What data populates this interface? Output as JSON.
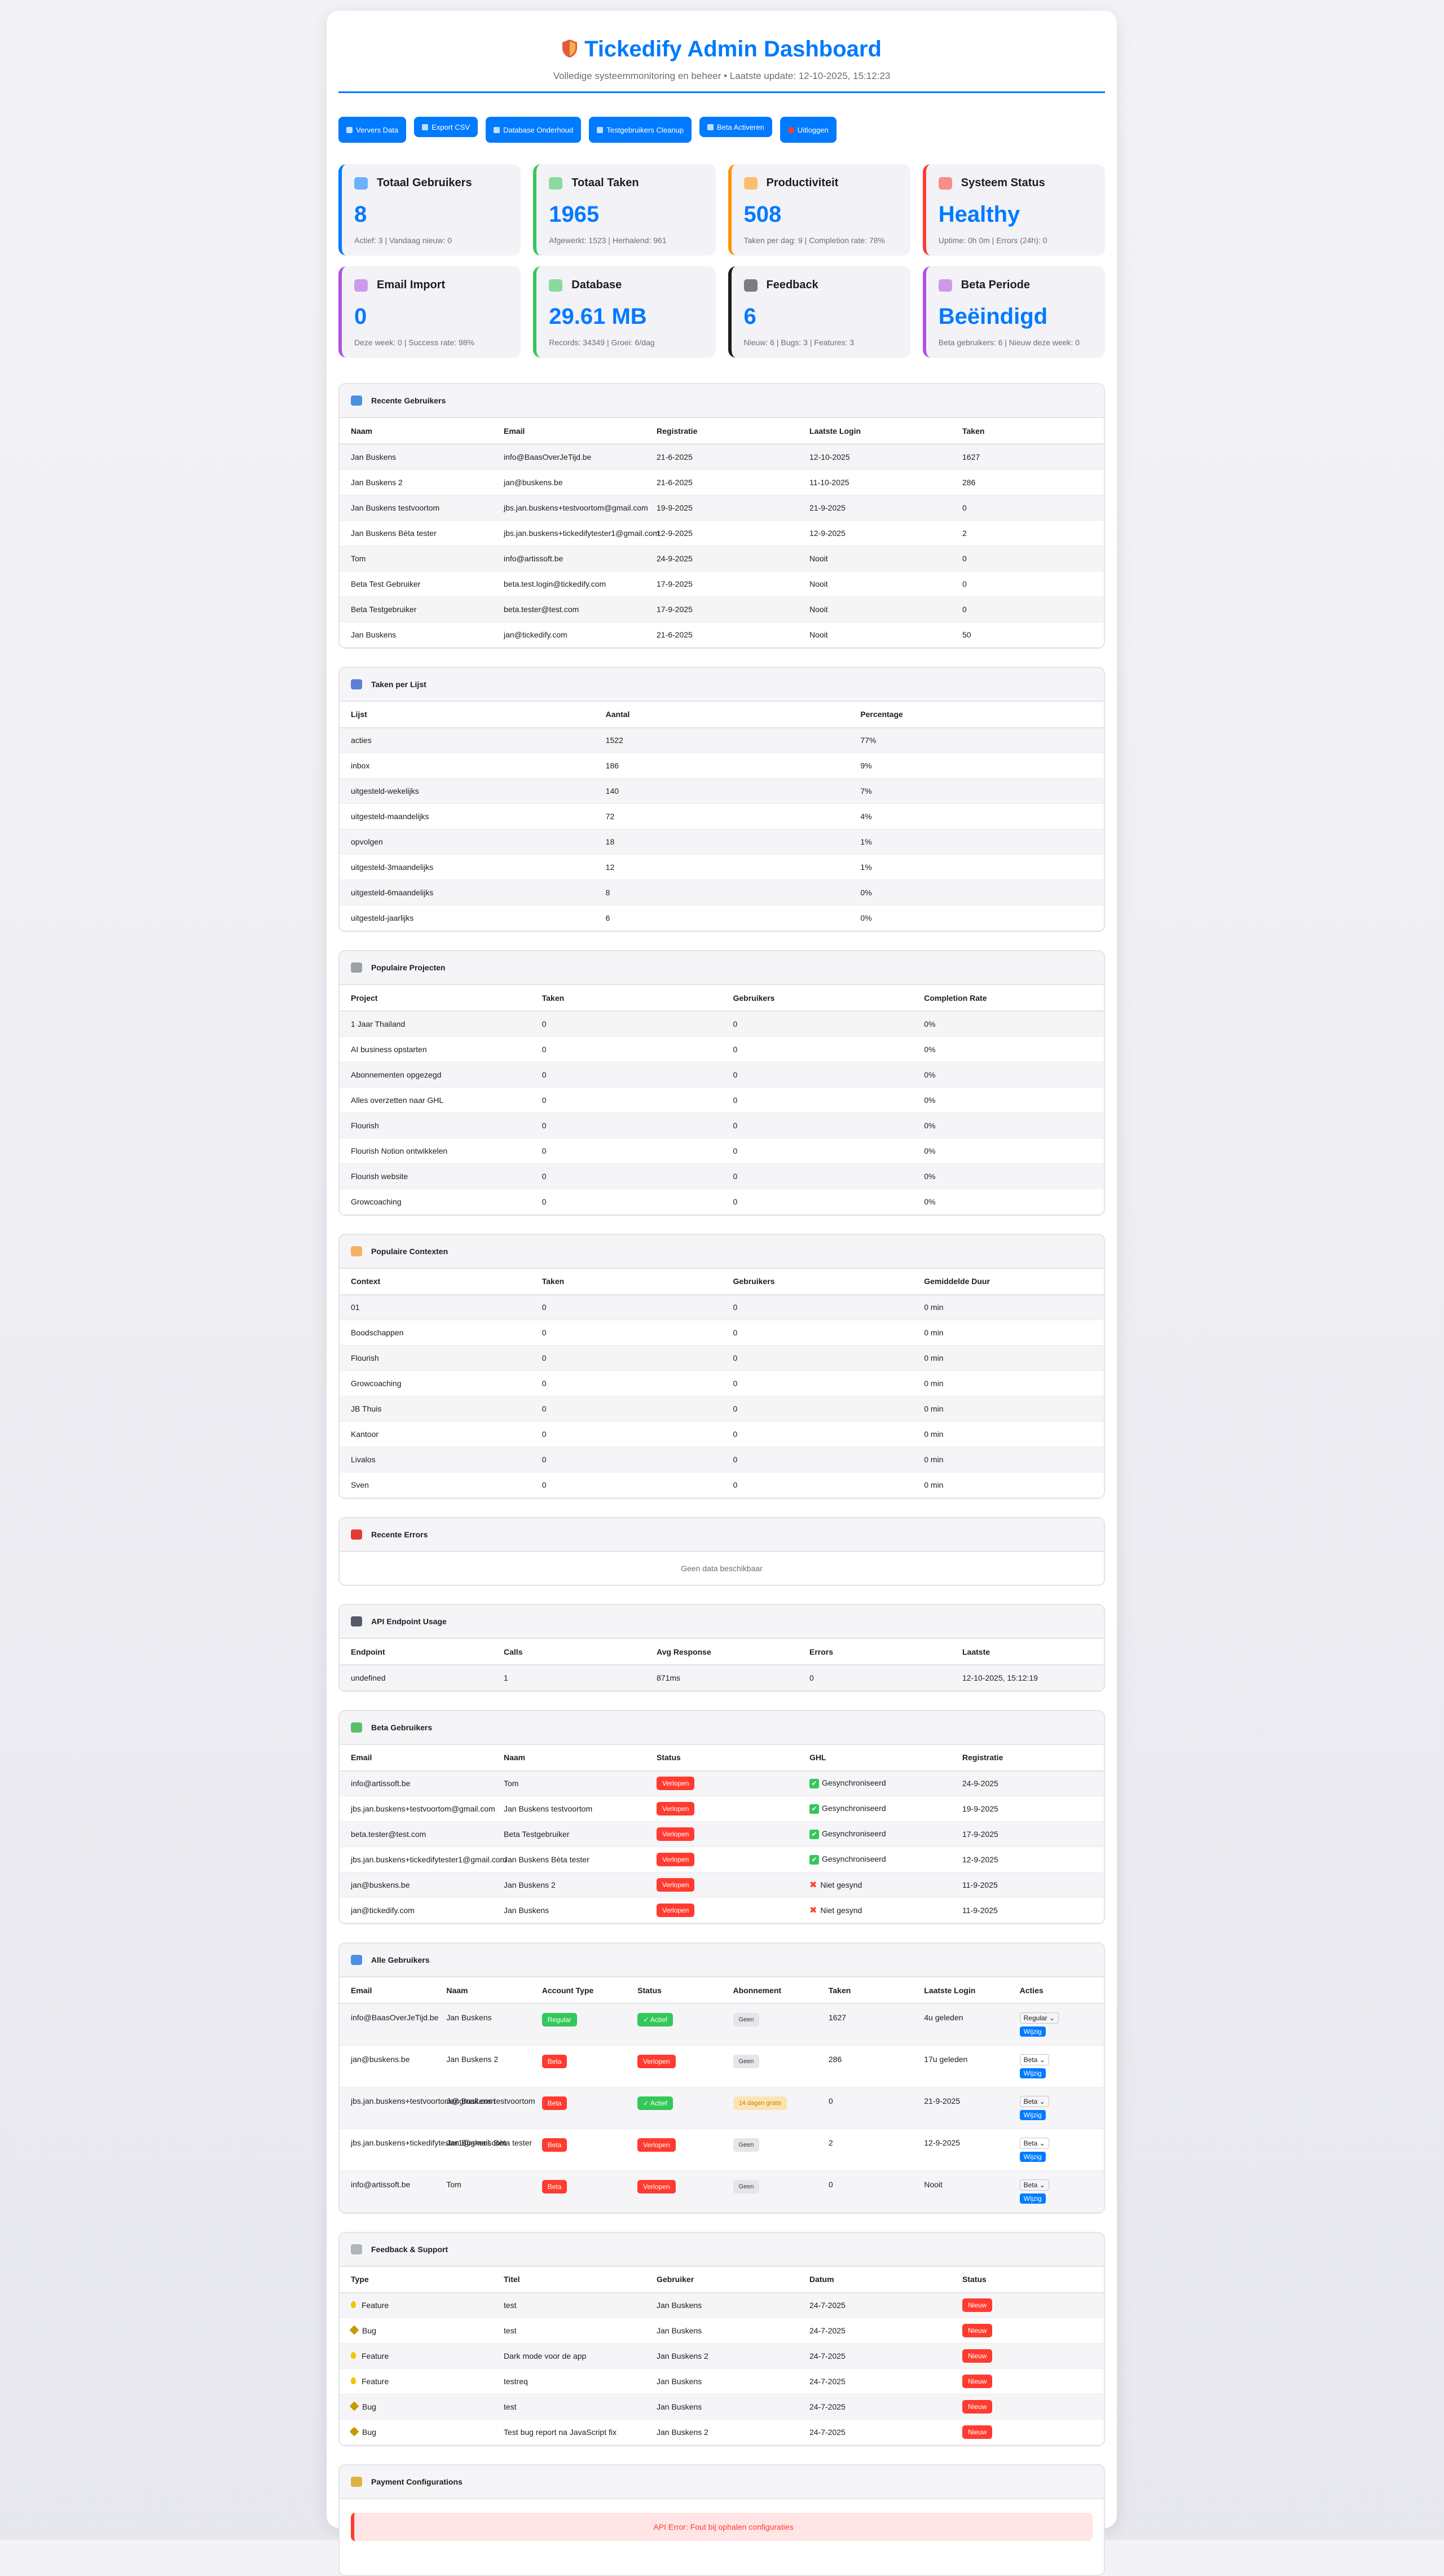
{
  "header": {
    "title": "Tickedify Admin Dashboard",
    "subtitle": "Volledige systeemmonitoring en beheer • Laatste update: 12-10-2025, 15:12:23"
  },
  "toolbar": {
    "buttons": [
      "Ververs Data",
      "Export CSV",
      "Database Onderhoud",
      "Testgebruikers Cleanup",
      "Beta Activeren",
      "Uitloggen"
    ]
  },
  "stats": [
    {
      "title": "Totaal Gebruikers",
      "value": "8",
      "detail": "Actief: 3 | Vandaag nieuw: 0",
      "color": "#007aff",
      "icon": "users-icon"
    },
    {
      "title": "Totaal Taken",
      "value": "1965",
      "detail": "Afgewerkt: 1523 | Herhalend: 961",
      "color": "#34c759",
      "icon": "calendar-icon"
    },
    {
      "title": "Productiviteit",
      "value": "508",
      "detail": "Taken per dag: 9 | Completion rate: 78%",
      "color": "#ff9500",
      "icon": "chart-up-icon"
    },
    {
      "title": "Systeem Status",
      "value": "Healthy",
      "detail": "Uptime: 0h 0m | Errors (24h): 0",
      "color": "#ff3b30",
      "icon": "siren-icon"
    },
    {
      "title": "Email Import",
      "value": "0",
      "detail": "Deze week: 0 | Success rate: 98%",
      "color": "#af52de",
      "icon": "envelope-icon"
    },
    {
      "title": "Database",
      "value": "29.61 MB",
      "detail": "Records: 34349 | Groei: 6/dag",
      "color": "#34c759",
      "icon": "floppy-icon"
    },
    {
      "title": "Feedback",
      "value": "6",
      "detail": "Nieuw: 6 | Bugs: 3 | Features: 3",
      "color": "#1d1d1f",
      "icon": "speech-bubble-icon"
    },
    {
      "title": "Beta Periode",
      "value": "Beëindigd",
      "detail": "Beta gebruikers: 6 | Nieuw deze week: 0",
      "color": "#af52de",
      "icon": "test-tube-icon"
    }
  ],
  "recent_users": {
    "title": "Recente Gebruikers",
    "columns": [
      "Naam",
      "Email",
      "Registratie",
      "Laatste Login",
      "Taken"
    ],
    "rows": [
      [
        "Jan Buskens",
        "info@BaasOverJeTijd.be",
        "21-6-2025",
        "12-10-2025",
        "1627"
      ],
      [
        "Jan Buskens 2",
        "jan@buskens.be",
        "21-6-2025",
        "11-10-2025",
        "286"
      ],
      [
        "Jan Buskens testvoortom",
        "jbs.jan.buskens+testvoortom@gmail.com",
        "19-9-2025",
        "21-9-2025",
        "0"
      ],
      [
        "Jan Buskens Bèta tester",
        "jbs.jan.buskens+tickedifytester1@gmail.com",
        "12-9-2025",
        "12-9-2025",
        "2"
      ],
      [
        "Tom",
        "info@artissoft.be",
        "24-9-2025",
        "Nooit",
        "0"
      ],
      [
        "Beta Test Gebruiker",
        "beta.test.login@tickedify.com",
        "17-9-2025",
        "Nooit",
        "0"
      ],
      [
        "Beta Testgebruiker",
        "beta.tester@test.com",
        "17-9-2025",
        "Nooit",
        "0"
      ],
      [
        "Jan Buskens",
        "jan@tickedify.com",
        "21-6-2025",
        "Nooit",
        "50"
      ]
    ]
  },
  "tasks_per_list": {
    "title": "Taken per Lijst",
    "columns": [
      "Lijst",
      "Aantal",
      "Percentage"
    ],
    "rows": [
      [
        "acties",
        "1522",
        "77%"
      ],
      [
        "inbox",
        "186",
        "9%"
      ],
      [
        "uitgesteld-wekelijks",
        "140",
        "7%"
      ],
      [
        "uitgesteld-maandelijks",
        "72",
        "4%"
      ],
      [
        "opvolgen",
        "18",
        "1%"
      ],
      [
        "uitgesteld-3maandelijks",
        "12",
        "1%"
      ],
      [
        "uitgesteld-6maandelijks",
        "8",
        "0%"
      ],
      [
        "uitgesteld-jaarlijks",
        "6",
        "0%"
      ]
    ]
  },
  "popular_projects": {
    "title": "Populaire Projecten",
    "columns": [
      "Project",
      "Taken",
      "Gebruikers",
      "Completion Rate"
    ],
    "rows": [
      [
        "1 Jaar Thailand",
        "0",
        "0",
        "0%"
      ],
      [
        "AI business opstarten",
        "0",
        "0",
        "0%"
      ],
      [
        "Abonnementen opgezegd",
        "0",
        "0",
        "0%"
      ],
      [
        "Alles overzetten naar GHL",
        "0",
        "0",
        "0%"
      ],
      [
        "Flourish",
        "0",
        "0",
        "0%"
      ],
      [
        "Flourish Notion ontwikkelen",
        "0",
        "0",
        "0%"
      ],
      [
        "Flourish website",
        "0",
        "0",
        "0%"
      ],
      [
        "Growcoaching",
        "0",
        "0",
        "0%"
      ]
    ]
  },
  "popular_contexts": {
    "title": "Populaire Contexten",
    "columns": [
      "Context",
      "Taken",
      "Gebruikers",
      "Gemiddelde Duur"
    ],
    "rows": [
      [
        "01",
        "0",
        "0",
        "0 min"
      ],
      [
        "Boodschappen",
        "0",
        "0",
        "0 min"
      ],
      [
        "Flourish",
        "0",
        "0",
        "0 min"
      ],
      [
        "Growcoaching",
        "0",
        "0",
        "0 min"
      ],
      [
        "JB Thuis",
        "0",
        "0",
        "0 min"
      ],
      [
        "Kantoor",
        "0",
        "0",
        "0 min"
      ],
      [
        "Livalos",
        "0",
        "0",
        "0 min"
      ],
      [
        "Sven",
        "0",
        "0",
        "0 min"
      ]
    ]
  },
  "recent_errors": {
    "title": "Recente Errors",
    "empty": "Geen data beschikbaar"
  },
  "api_usage": {
    "title": "API Endpoint Usage",
    "columns": [
      "Endpoint",
      "Calls",
      "Avg Response",
      "Errors",
      "Laatste"
    ],
    "rows": [
      [
        "undefined",
        "1",
        "871ms",
        "0",
        "12-10-2025, 15:12:19"
      ]
    ]
  },
  "beta_users": {
    "title": "Beta Gebruikers",
    "columns": [
      "Email",
      "Naam",
      "Status",
      "GHL",
      "Registratie"
    ],
    "rows": [
      {
        "email": "info@artissoft.be",
        "name": "Tom",
        "status": "Verlopen",
        "ghl": "Gesynchroniseerd",
        "ghl_ok": true,
        "reg": "24-9-2025"
      },
      {
        "email": "jbs.jan.buskens+testvoortom@gmail.com",
        "name": "Jan Buskens testvoortom",
        "status": "Verlopen",
        "ghl": "Gesynchroniseerd",
        "ghl_ok": true,
        "reg": "19-9-2025"
      },
      {
        "email": "beta.tester@test.com",
        "name": "Beta Testgebruiker",
        "status": "Verlopen",
        "ghl": "Gesynchroniseerd",
        "ghl_ok": true,
        "reg": "17-9-2025"
      },
      {
        "email": "jbs.jan.buskens+tickedifytester1@gmail.com",
        "name": "Jan Buskens Bèta tester",
        "status": "Verlopen",
        "ghl": "Gesynchroniseerd",
        "ghl_ok": true,
        "reg": "12-9-2025"
      },
      {
        "email": "jan@buskens.be",
        "name": "Jan Buskens 2",
        "status": "Verlopen",
        "ghl": "Niet gesynd",
        "ghl_ok": false,
        "reg": "11-9-2025"
      },
      {
        "email": "jan@tickedify.com",
        "name": "Jan Buskens",
        "status": "Verlopen",
        "ghl": "Niet gesynd",
        "ghl_ok": false,
        "reg": "11-9-2025"
      }
    ]
  },
  "all_users": {
    "title": "Alle Gebruikers",
    "columns": [
      "Email",
      "Naam",
      "Account Type",
      "Status",
      "Abonnement",
      "Taken",
      "Laatste Login",
      "Acties"
    ],
    "edit_label": "Wijzig",
    "rows": [
      {
        "email": "info@BaasOverJeTijd.be",
        "name": "Jan Buskens",
        "type": "Regular",
        "type_color": "#34c759",
        "status": "✓ Actief",
        "status_color": "#34c759",
        "sub": "Geen",
        "sub_style": "gray",
        "tasks": "1627",
        "login": "4u geleden",
        "select": "Regular"
      },
      {
        "email": "jan@buskens.be",
        "name": "Jan Buskens 2",
        "type": "Beta",
        "type_color": "#ff3b30",
        "status": "Verlopen",
        "status_color": "#ff3b30",
        "sub": "Geen",
        "sub_style": "gray",
        "tasks": "286",
        "login": "17u geleden",
        "select": "Beta"
      },
      {
        "email": "jbs.jan.buskens+testvoortom@gmail.com",
        "name": "Jan Buskens testvoortom",
        "type": "Beta",
        "type_color": "#ff3b30",
        "status": "✓ Actief",
        "status_color": "#34c759",
        "sub": "14 dagen gratis",
        "sub_style": "amber",
        "tasks": "0",
        "login": "21-9-2025",
        "select": "Beta"
      },
      {
        "email": "jbs.jan.buskens+tickedifytester1@gmail.com",
        "name": "Jan Buskens Bèta tester",
        "type": "Beta",
        "type_color": "#ff3b30",
        "status": "Verlopen",
        "status_color": "#ff3b30",
        "sub": "Geen",
        "sub_style": "gray",
        "tasks": "2",
        "login": "12-9-2025",
        "select": "Beta"
      },
      {
        "email": "info@artissoft.be",
        "name": "Tom",
        "type": "Beta",
        "type_color": "#ff3b30",
        "status": "Verlopen",
        "status_color": "#ff3b30",
        "sub": "Geen",
        "sub_style": "gray",
        "tasks": "0",
        "login": "Nooit",
        "select": "Beta"
      }
    ]
  },
  "feedback": {
    "title": "Feedback & Support",
    "columns": [
      "Type",
      "Titel",
      "Gebruiker",
      "Datum",
      "Status"
    ],
    "rows": [
      {
        "type": "Feature",
        "icon": "bulb-icon",
        "title": "test",
        "user": "Jan Buskens",
        "date": "24-7-2025",
        "status": "Nieuw"
      },
      {
        "type": "Bug",
        "icon": "bug-icon",
        "title": "test",
        "user": "Jan Buskens",
        "date": "24-7-2025",
        "status": "Nieuw"
      },
      {
        "type": "Feature",
        "icon": "bulb-icon",
        "title": "Dark mode voor de app",
        "user": "Jan Buskens 2",
        "date": "24-7-2025",
        "status": "Nieuw"
      },
      {
        "type": "Feature",
        "icon": "bulb-icon",
        "title": "testreq",
        "user": "Jan Buskens",
        "date": "24-7-2025",
        "status": "Nieuw"
      },
      {
        "type": "Bug",
        "icon": "bug-icon",
        "title": "test",
        "user": "Jan Buskens",
        "date": "24-7-2025",
        "status": "Nieuw"
      },
      {
        "type": "Bug",
        "icon": "bug-icon",
        "title": "Test bug report na JavaScript fix",
        "user": "Jan Buskens 2",
        "date": "24-7-2025",
        "status": "Nieuw"
      }
    ]
  },
  "payment": {
    "title": "Payment Configurations",
    "error": "API Error: Fout bij ophalen configuraties"
  }
}
